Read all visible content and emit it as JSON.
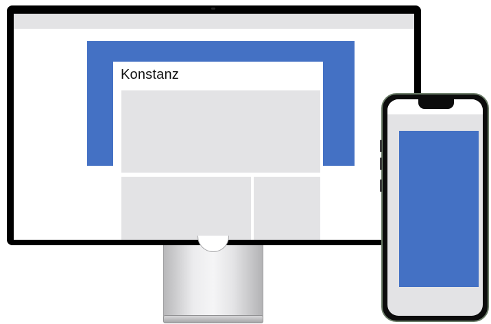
{
  "monitor": {
    "card": {
      "title": "Konstanz"
    }
  },
  "colors": {
    "accent": "#4471c4",
    "placeholder": "#e3e3e5",
    "frame": "#000000"
  }
}
